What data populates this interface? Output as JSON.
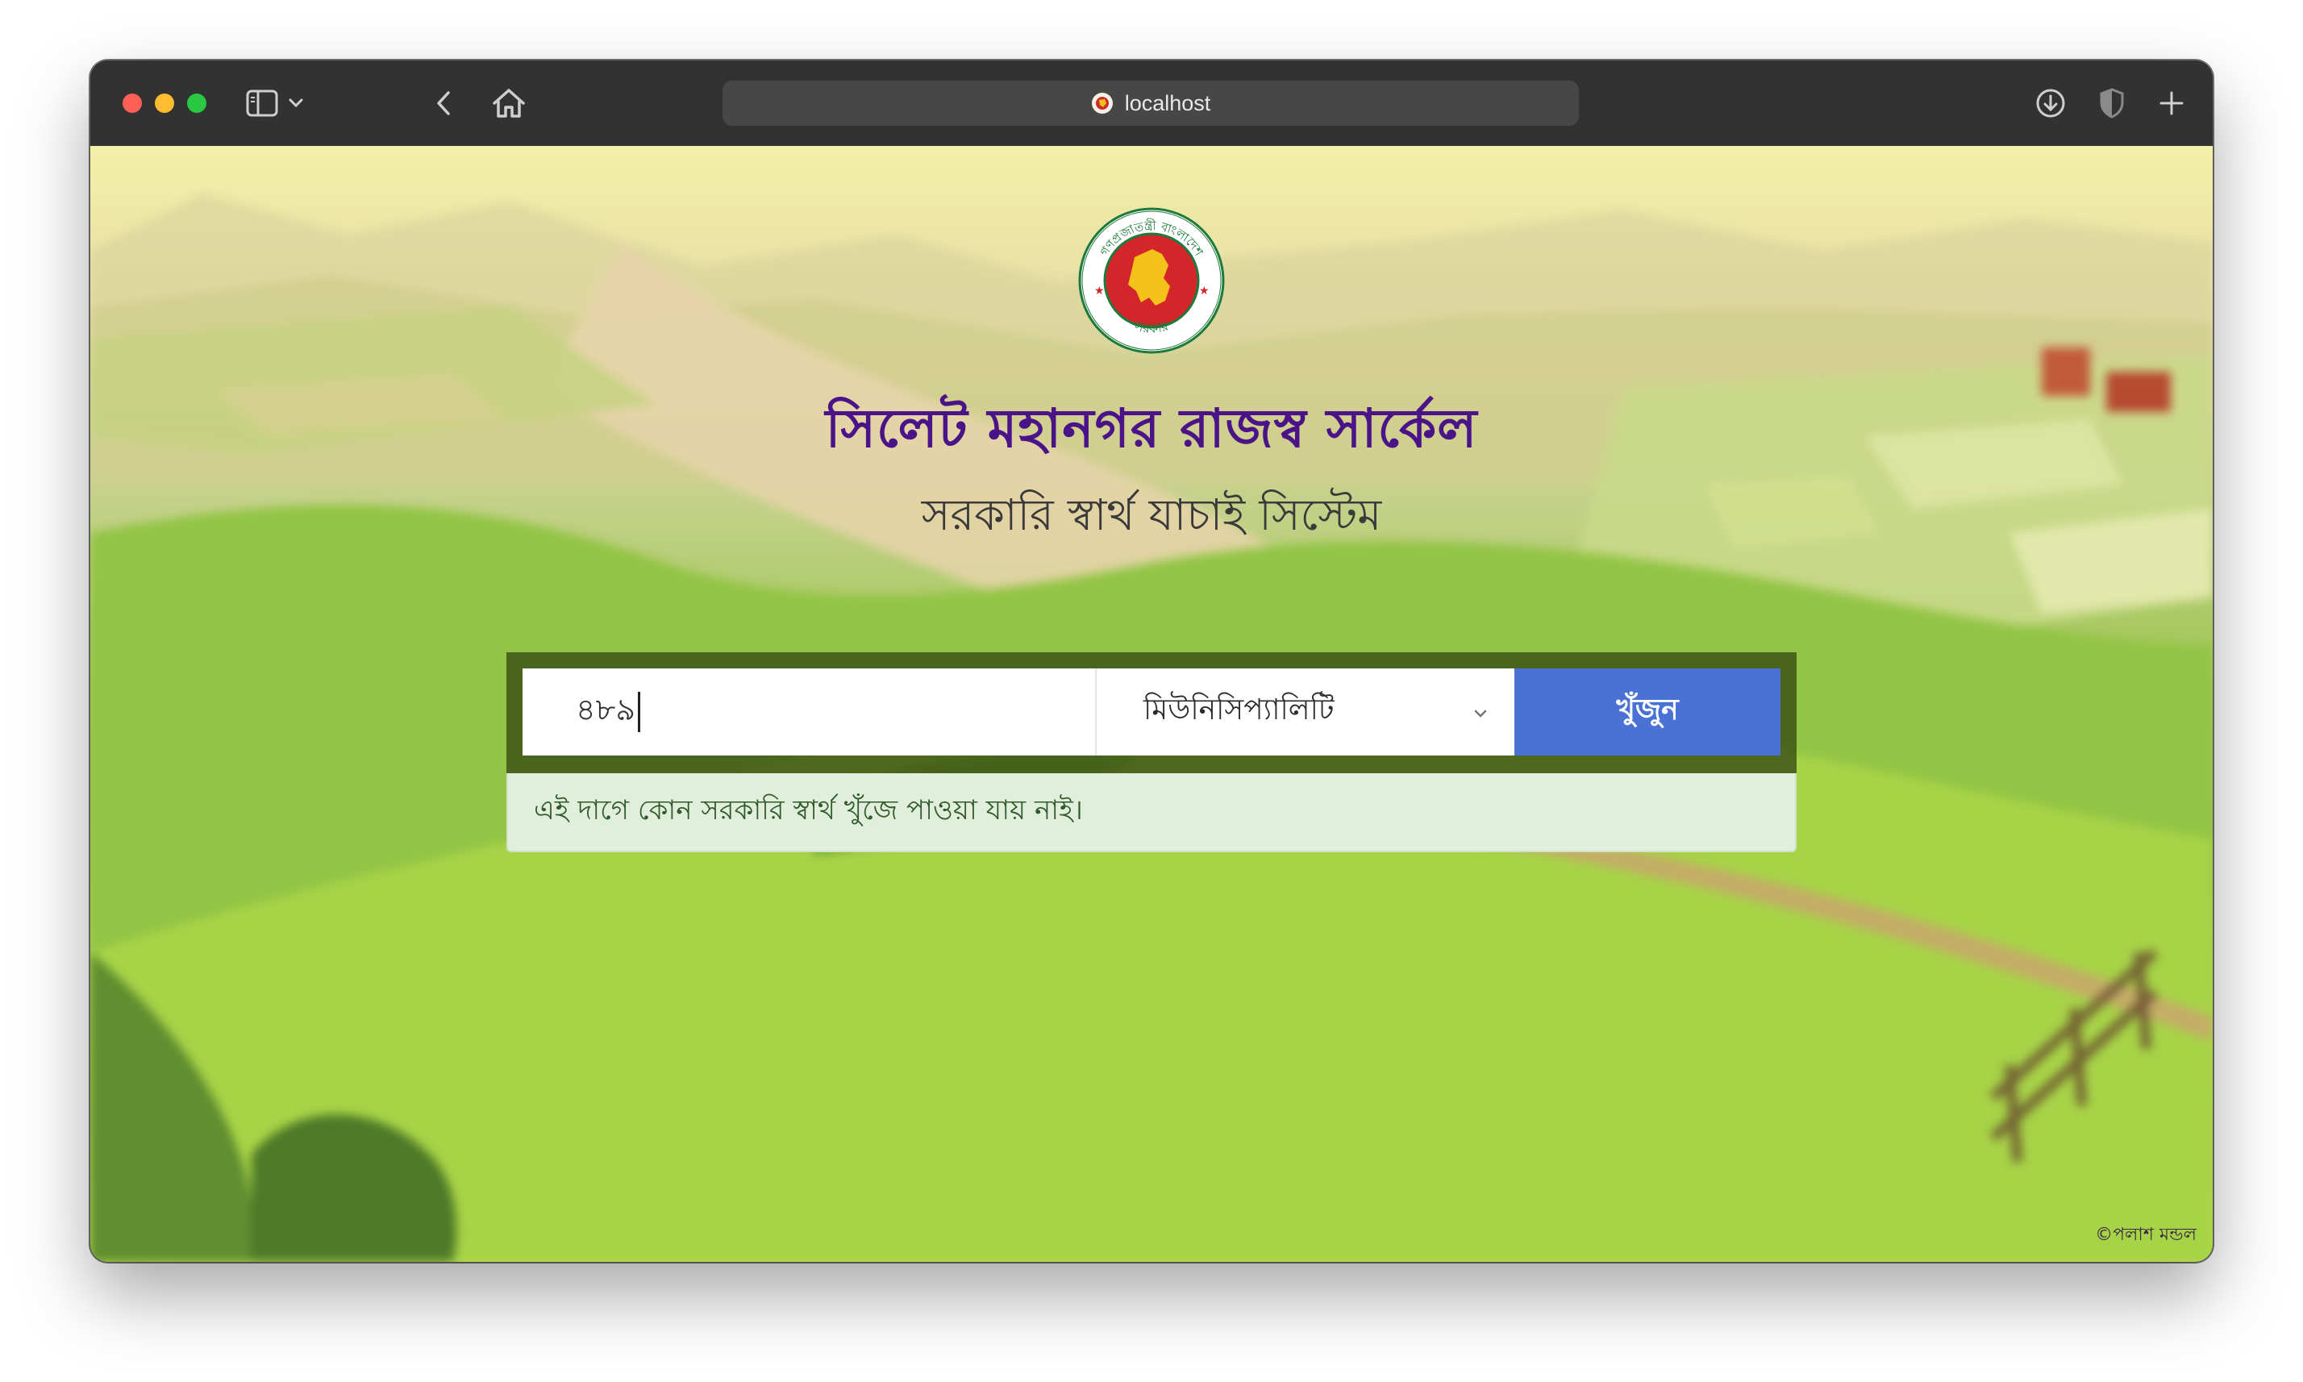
{
  "browser": {
    "url": "localhost",
    "icons": [
      "sidebar-icon",
      "chevron-down-icon",
      "back-icon",
      "home-icon",
      "site-favicon",
      "download-icon",
      "shield-icon",
      "plus-icon"
    ]
  },
  "page": {
    "title": "সিলেট মহানগর রাজস্ব সার্কেল",
    "subtitle": "সরকারি স্বার্থ যাচাই সিস্টেম",
    "emblem": {
      "top_text": "গণপ্রজাতন্ত্রী বাংলাদেশ",
      "bottom_text": "সরকার"
    },
    "search": {
      "input_value": "৪৮৯",
      "selected_option": "মিউনিসিপ্যালিটি",
      "button_label": "খুঁজুন"
    },
    "result_message": "এই দাগে কোন সরকারি স্বার্থ খুঁজে পাওয়া যায় নাই।",
    "copyright": "©পলাশ মন্ডল"
  },
  "colors": {
    "title": "#4a1387",
    "button": "#4a72d6",
    "panel": "#3a5216",
    "result_bg": "#e2eedc",
    "result_text": "#2f5a2a"
  }
}
